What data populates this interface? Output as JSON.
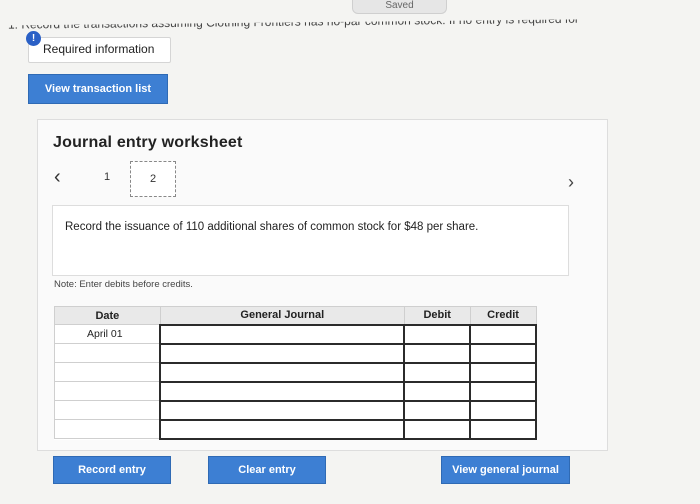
{
  "header": {
    "saved_label": "Saved",
    "instruction_fragment": "1. Record the transactions assuming Clothing Frontiers has no-par common stock. If no entry is required for"
  },
  "required": {
    "badge": "!",
    "label": "Required information"
  },
  "buttons": {
    "view_transaction_list": "View transaction list",
    "record_entry": "Record entry",
    "clear_entry": "Clear entry",
    "view_general_journal": "View general journal"
  },
  "worksheet": {
    "title": "Journal entry worksheet",
    "prev_icon": "‹",
    "next_icon": "›",
    "pages": [
      "1",
      "2"
    ],
    "current_page": "2",
    "instruction": "Record the issuance of 110 additional shares of common stock for $48 per share.",
    "note": "Note: Enter debits before credits."
  },
  "journal": {
    "headers": [
      "Date",
      "General Journal",
      "Debit",
      "Credit"
    ],
    "rows": [
      {
        "date": "April 01",
        "account": "",
        "debit": "",
        "credit": ""
      },
      {
        "date": "",
        "account": "",
        "debit": "",
        "credit": ""
      },
      {
        "date": "",
        "account": "",
        "debit": "",
        "credit": ""
      },
      {
        "date": "",
        "account": "",
        "debit": "",
        "credit": ""
      },
      {
        "date": "",
        "account": "",
        "debit": "",
        "credit": ""
      },
      {
        "date": "",
        "account": "",
        "debit": "",
        "credit": ""
      }
    ]
  },
  "colors": {
    "accent": "#3d7fd3",
    "badge": "#2a60c6"
  }
}
